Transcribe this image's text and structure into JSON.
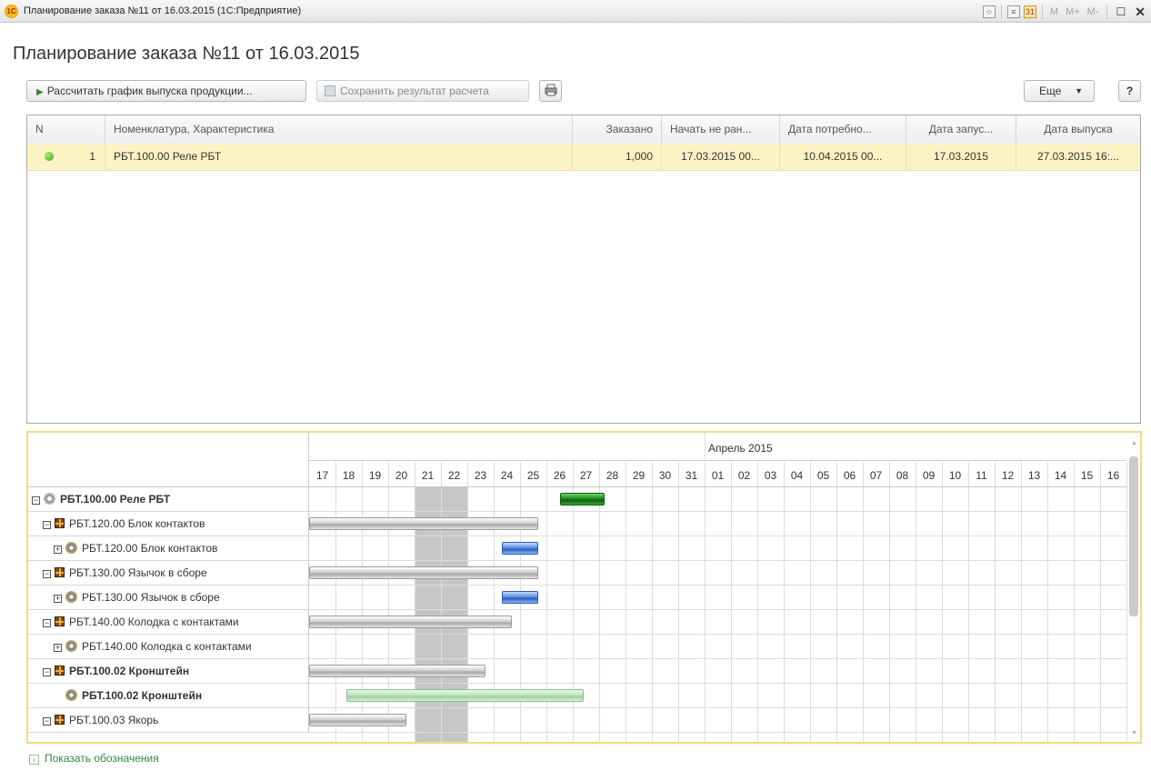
{
  "window": {
    "title": "Планирование заказа №11 от 16.03.2015  (1С:Предприятие)",
    "toolbar_m": "M",
    "toolbar_mplus": "M+",
    "toolbar_mminus": "M-"
  },
  "page": {
    "title": "Планирование заказа №11 от 16.03.2015"
  },
  "commands": {
    "calculate": "Рассчитать график выпуска продукции...",
    "save": "Сохранить результат расчета",
    "more": "Еще",
    "help": "?"
  },
  "table": {
    "columns": [
      "N",
      "Номенклатура, Характеристика",
      "Заказано",
      "Начать не ран...",
      "Дата потребно...",
      "Дата запус...",
      "Дата выпуска"
    ],
    "rows": [
      {
        "n": "1",
        "nomenclature": "РБТ.100.00 Реле РБТ",
        "ordered": "1,000",
        "start_not_before": "17.03.2015 00...",
        "need_date": "10.04.2015 00...",
        "launch_date": "17.03.2015",
        "release_date": "27.03.2015 16:..."
      }
    ]
  },
  "gantt": {
    "month_label": "Апрель 2015",
    "month_start_index": 15,
    "weekend_start_index": 4,
    "weekend_length_days": 2,
    "days": [
      "17",
      "18",
      "19",
      "20",
      "21",
      "22",
      "23",
      "24",
      "25",
      "26",
      "27",
      "28",
      "29",
      "30",
      "31",
      "01",
      "02",
      "03",
      "04",
      "05",
      "06",
      "07",
      "08",
      "09",
      "10",
      "11",
      "12",
      "13",
      "14",
      "15",
      "16"
    ],
    "rows": [
      {
        "label": "РБТ.100.00 Реле РБТ",
        "bold": true,
        "indent": 0,
        "toggle": "minus",
        "icon": "gear",
        "bars": [
          {
            "style": "green",
            "start_day": 9.5,
            "end_day": 11.2
          }
        ]
      },
      {
        "label": "РБТ.120.00 Блок контактов",
        "bold": false,
        "indent": 1,
        "toggle": "minus",
        "icon": "box",
        "bars": [
          {
            "style": "gray",
            "start_day": 0,
            "end_day": 8.7
          }
        ]
      },
      {
        "label": "РБТ.120.00 Блок контактов",
        "bold": false,
        "indent": 2,
        "toggle": "plus",
        "icon": "gear-color",
        "bars": [
          {
            "style": "blue",
            "start_day": 7.3,
            "end_day": 8.7
          }
        ]
      },
      {
        "label": "РБТ.130.00 Язычок в сборе",
        "bold": false,
        "indent": 1,
        "toggle": "minus",
        "icon": "box",
        "bars": [
          {
            "style": "gray",
            "start_day": 0,
            "end_day": 8.7
          }
        ]
      },
      {
        "label": "РБТ.130.00 Язычок в сборе",
        "bold": false,
        "indent": 2,
        "toggle": "plus",
        "icon": "gear-color",
        "bars": [
          {
            "style": "blue",
            "start_day": 7.3,
            "end_day": 8.7
          }
        ]
      },
      {
        "label": "РБТ.140.00 Колодка с контактами",
        "bold": false,
        "indent": 1,
        "toggle": "minus",
        "icon": "box",
        "bars": [
          {
            "style": "gray",
            "start_day": 0,
            "end_day": 7.7
          }
        ]
      },
      {
        "label": "РБТ.140.00 Колодка с контактами",
        "bold": false,
        "indent": 2,
        "toggle": "plus",
        "icon": "gear-color",
        "bars": []
      },
      {
        "label": "РБТ.100.02 Кронштейн",
        "bold": true,
        "indent": 1,
        "toggle": "minus",
        "icon": "box",
        "bars": [
          {
            "style": "gray",
            "start_day": 0,
            "end_day": 6.7
          }
        ]
      },
      {
        "label": "РБТ.100.02 Кронштейн",
        "bold": true,
        "indent": 2,
        "toggle": "none",
        "icon": "gear-color",
        "bars": [
          {
            "style": "lgreen",
            "start_day": 1.4,
            "end_day": 10.4
          }
        ]
      },
      {
        "label": "РБТ.100.03 Якорь",
        "bold": false,
        "indent": 1,
        "toggle": "minus",
        "icon": "box",
        "bars": [
          {
            "style": "gray",
            "start_day": 0,
            "end_day": 3.7
          }
        ]
      }
    ]
  },
  "legend_link": "Показать обозначения",
  "colors": {
    "accent_link": "#2a8a3a",
    "selected_row": "#fcf3c4",
    "gantt_border": "#f2dc7d"
  }
}
